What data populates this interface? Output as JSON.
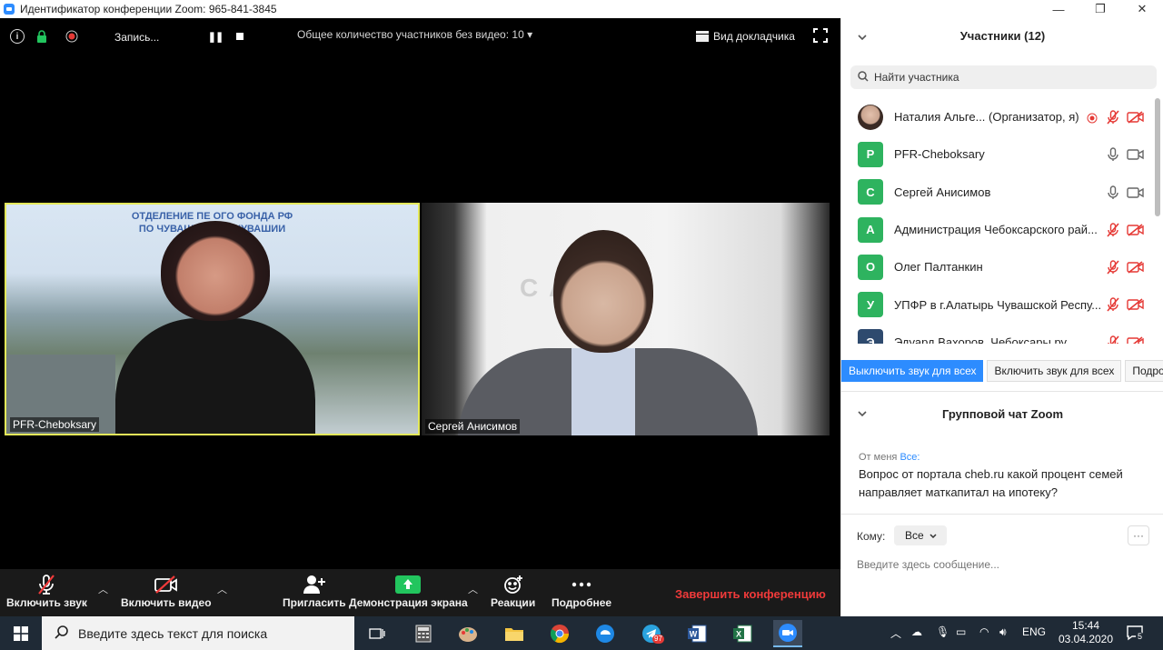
{
  "window": {
    "title": "Идентификатор конференции Zoom: 965-841-3845",
    "minimize": "—",
    "restore": "❐",
    "close": "✕"
  },
  "topbar": {
    "recording_label": "Запись...",
    "total_no_video": "Общее количество участников без видео: 10",
    "view_label": "Вид докладчика"
  },
  "videos": [
    {
      "name": "PFR-Cheboksary",
      "banner_line1": "ОТДЕЛЕНИЕ ПЕ          ОГО ФОНДА РФ",
      "banner_line2": "ПО ЧУВАШСК          КЕ – ЧУВАШИИ"
    },
    {
      "name": "Сергей Анисимов",
      "logo": "С     АНК"
    }
  ],
  "toolbar": {
    "unmute": "Включить звук",
    "start_video": "Включить видео",
    "invite": "Пригласить",
    "share": "Демонстрация экрана",
    "reactions": "Реакции",
    "more": "Подробнее",
    "end": "Завершить конференцию"
  },
  "participants": {
    "header": "Участники (12)",
    "search_placeholder": "Найти участника",
    "list": [
      {
        "initial": "",
        "name": "Наталия Альге...  (Организатор, я)",
        "color": "#c9a48f"
      },
      {
        "initial": "P",
        "name": "PFR-Cheboksary",
        "color": "#2eb35f"
      },
      {
        "initial": "С",
        "name": "Сергей Анисимов",
        "color": "#2eb35f"
      },
      {
        "initial": "А",
        "name": "Администрация Чебоксарского рай...",
        "color": "#2eb35f"
      },
      {
        "initial": "О",
        "name": "Олег Палтанкин",
        "color": "#2eb35f"
      },
      {
        "initial": "У",
        "name": "УПФР в г.Алатырь Чувашской Респу...",
        "color": "#2eb35f"
      },
      {
        "initial": "Э",
        "name": "Эдуард Вахоров, Чебоксары.ру",
        "color": "#2e4a6e"
      }
    ],
    "btn_mute_all": "Выключить звук для всех",
    "btn_unmute_all": "Включить звук для всех",
    "btn_more": "Подробнее"
  },
  "chat": {
    "header": "Групповой чат Zoom",
    "from": "От меня",
    "to": "Все:",
    "message": "Вопрос от портала cheb.ru какой процент семей направляет маткапитал на ипотеку?",
    "to_label": "Кому:",
    "to_value": "Все",
    "more": "···",
    "input_placeholder": "Введите здесь сообщение..."
  },
  "taskbar": {
    "search_placeholder": "Введите здесь текст для поиска",
    "telegram_badge": "97",
    "lang": "ENG",
    "time": "15:44",
    "date": "03.04.2020",
    "notifications": "5"
  }
}
